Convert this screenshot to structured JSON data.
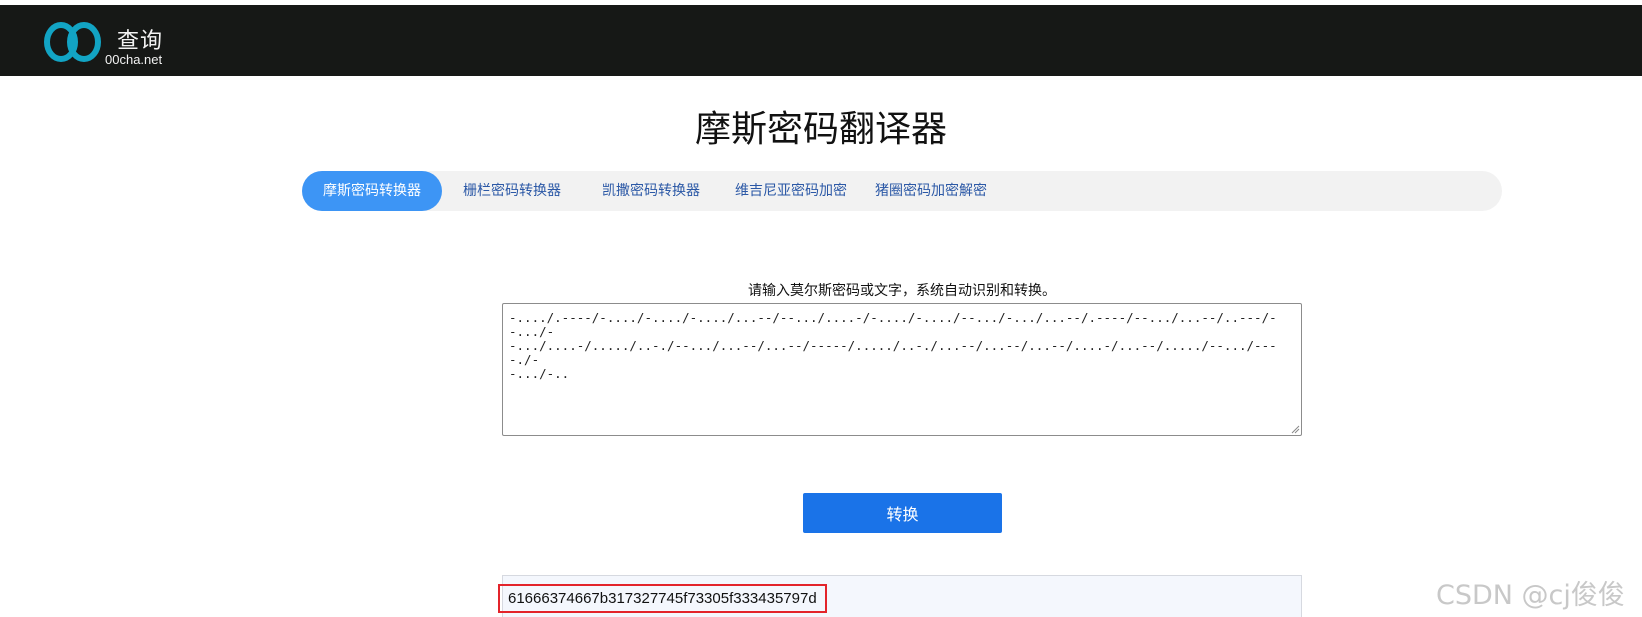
{
  "header": {
    "logo_cn": "查询",
    "logo_en": "00cha.net",
    "colors": {
      "background": "#161816",
      "logo_blue": "#12a4c4"
    }
  },
  "main": {
    "title": "摩斯密码翻译器",
    "tabs": [
      {
        "label": "摩斯密码转换器",
        "active": true
      },
      {
        "label": "栅栏密码转换器",
        "active": false
      },
      {
        "label": "凯撒密码转换器",
        "active": false
      },
      {
        "label": "维吉尼亚密码加密",
        "active": false
      },
      {
        "label": "猪圈密码加密解密",
        "active": false
      }
    ],
    "hint": "请输入莫尔斯密码或文字，系统自动识别和转换。",
    "input_value": "-..../.----/-..../-..../-..../...--/--.../....-/-..../-..../--.../-.../...--/.----/--.../...--/..---/--.../-\n-.../....-/...../..-./--.../...--/...--/-----/...../..-./...--/...--/...--/....-/...--/...../--.../----./-\n-.../-..",
    "convert_label": "转换",
    "result": "61666374667b317327745f73305f333435797d"
  },
  "watermark": "CSDN @cj俊俊",
  "colors": {
    "tab_active": "#3d95f5",
    "tab_text": "#2b58a6",
    "button": "#1a73e8",
    "highlight": "#e3242b"
  }
}
